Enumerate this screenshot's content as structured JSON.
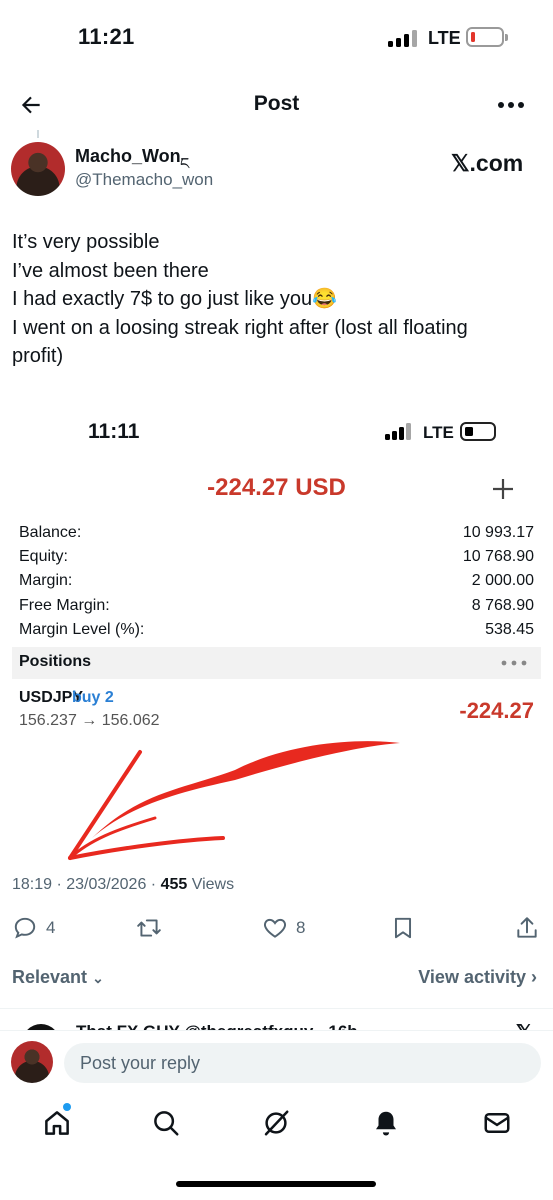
{
  "status_bar": {
    "time": "11:21",
    "network": "LTE"
  },
  "header": {
    "title": "Post"
  },
  "author": {
    "name": "Macho_Won",
    "badge": "ང",
    "handle": "@Themacho_won",
    "watermark": "𝕏.com"
  },
  "tweet": {
    "lines": [
      "It’s very possible",
      "I’ve almost been there",
      "I had exactly 7$ to go just like you😂",
      "I went on a loosing streak right after (lost all floating profit)"
    ]
  },
  "embedded": {
    "time": "11:11",
    "network": "LTE",
    "total_pl": "-224.27 USD",
    "account": [
      {
        "label": "Balance:",
        "value": "10 993.17"
      },
      {
        "label": "Equity:",
        "value": "10 768.90"
      },
      {
        "label": "Margin:",
        "value": "2 000.00"
      },
      {
        "label": "Free Margin:",
        "value": "8 768.90"
      },
      {
        "label": "Margin Level (%):",
        "value": "538.45"
      }
    ],
    "positions_label": "Positions",
    "position": {
      "symbol": "USDJPY",
      "side": "buy 2",
      "prices": "156.237 → 156.062",
      "pl": "-224.27"
    },
    "arrow_color": "#e8291f"
  },
  "meta": {
    "time_date": "18:19 · 23/03/2026 · ",
    "views_count": "455",
    "views_label": " Views"
  },
  "actions": {
    "replies": "4",
    "likes": "8"
  },
  "replies_section": {
    "sort_label": "Relevant",
    "activity_label": "View activity"
  },
  "peek": {
    "text": "That FX GUY  @thegreatfxguy · 16h",
    "x": "𝕏"
  },
  "composer": {
    "placeholder": "Post your reply"
  },
  "colors": {
    "loss": "#c9392b",
    "link_blue": "#2a7fd4",
    "accent": "#1d9bf0"
  }
}
